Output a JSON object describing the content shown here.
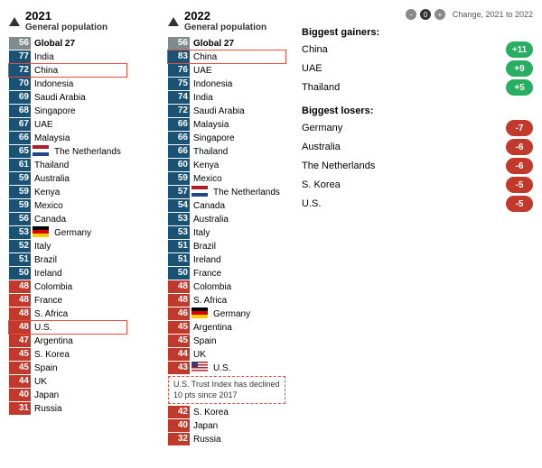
{
  "header2021": {
    "year": "2021",
    "sub": "General population"
  },
  "header2022": {
    "year": "2022",
    "sub": "General population"
  },
  "legend": {
    "change_label": "Change, 2021 to 2022",
    "biggest_gainers_title": "Biggest gainers:",
    "biggest_losers_title": "Biggest losers:",
    "gainers": [
      {
        "country": "China",
        "change": "+11"
      },
      {
        "country": "UAE",
        "change": "+9"
      },
      {
        "country": "Thailand",
        "change": "+5"
      }
    ],
    "losers": [
      {
        "country": "Germany",
        "change": "-7"
      },
      {
        "country": "Australia",
        "change": "-6"
      },
      {
        "country": "The Netherlands",
        "change": "-6"
      },
      {
        "country": "S. Korea",
        "change": "-5"
      },
      {
        "country": "U.S.",
        "change": "-5"
      }
    ]
  },
  "col2021": [
    {
      "score": "56",
      "name": "Global 27",
      "type": "global"
    },
    {
      "score": "77",
      "name": "India",
      "type": "blue"
    },
    {
      "score": "72",
      "name": "China",
      "type": "blue",
      "highlight": true
    },
    {
      "score": "70",
      "name": "Indonesia",
      "type": "blue"
    },
    {
      "score": "69",
      "name": "Saudi Arabia",
      "type": "blue"
    },
    {
      "score": "68",
      "name": "Singapore",
      "type": "blue"
    },
    {
      "score": "67",
      "name": "UAE",
      "type": "blue"
    },
    {
      "score": "66",
      "name": "Malaysia",
      "type": "blue"
    },
    {
      "score": "65",
      "name": "The Netherlands",
      "type": "blue",
      "flag": "nl"
    },
    {
      "score": "61",
      "name": "Thailand",
      "type": "blue"
    },
    {
      "score": "59",
      "name": "Australia",
      "type": "blue"
    },
    {
      "score": "59",
      "name": "Kenya",
      "type": "blue"
    },
    {
      "score": "59",
      "name": "Mexico",
      "type": "blue"
    },
    {
      "score": "56",
      "name": "Canada",
      "type": "blue"
    },
    {
      "score": "53",
      "name": "Germany",
      "type": "blue",
      "flag": "de"
    },
    {
      "score": "52",
      "name": "Italy",
      "type": "blue"
    },
    {
      "score": "51",
      "name": "Brazil",
      "type": "blue"
    },
    {
      "score": "50",
      "name": "Ireland",
      "type": "blue"
    },
    {
      "score": "48",
      "name": "Colombia",
      "type": "red"
    },
    {
      "score": "48",
      "name": "France",
      "type": "red"
    },
    {
      "score": "48",
      "name": "S. Africa",
      "type": "red"
    },
    {
      "score": "48",
      "name": "U.S.",
      "type": "red",
      "highlight": true
    },
    {
      "score": "47",
      "name": "Argentina",
      "type": "red"
    },
    {
      "score": "45",
      "name": "S. Korea",
      "type": "red"
    },
    {
      "score": "45",
      "name": "Spain",
      "type": "red"
    },
    {
      "score": "44",
      "name": "UK",
      "type": "red"
    },
    {
      "score": "40",
      "name": "Japan",
      "type": "red"
    },
    {
      "score": "31",
      "name": "Russia",
      "type": "red"
    }
  ],
  "col2022": [
    {
      "score": "56",
      "name": "Global 27",
      "type": "global"
    },
    {
      "score": "83",
      "name": "China",
      "type": "blue",
      "highlight": true
    },
    {
      "score": "76",
      "name": "UAE",
      "type": "blue"
    },
    {
      "score": "75",
      "name": "Indonesia",
      "type": "blue"
    },
    {
      "score": "74",
      "name": "India",
      "type": "blue"
    },
    {
      "score": "72",
      "name": "Saudi Arabia",
      "type": "blue"
    },
    {
      "score": "66",
      "name": "Malaysia",
      "type": "blue"
    },
    {
      "score": "66",
      "name": "Singapore",
      "type": "blue"
    },
    {
      "score": "66",
      "name": "Thailand",
      "type": "blue"
    },
    {
      "score": "60",
      "name": "Kenya",
      "type": "blue"
    },
    {
      "score": "59",
      "name": "Mexico",
      "type": "blue"
    },
    {
      "score": "57",
      "name": "The Netherlands",
      "type": "blue",
      "flag": "nl"
    },
    {
      "score": "54",
      "name": "Canada",
      "type": "blue"
    },
    {
      "score": "53",
      "name": "Australia",
      "type": "blue"
    },
    {
      "score": "53",
      "name": "Italy",
      "type": "blue"
    },
    {
      "score": "51",
      "name": "Brazil",
      "type": "blue"
    },
    {
      "score": "51",
      "name": "Ireland",
      "type": "blue"
    },
    {
      "score": "50",
      "name": "France",
      "type": "blue"
    },
    {
      "score": "48",
      "name": "Colombia",
      "type": "red"
    },
    {
      "score": "48",
      "name": "S. Africa",
      "type": "red"
    },
    {
      "score": "46",
      "name": "Germany",
      "type": "red",
      "flag": "de"
    },
    {
      "score": "45",
      "name": "Argentina",
      "type": "red"
    },
    {
      "score": "45",
      "name": "Spain",
      "type": "red"
    },
    {
      "score": "44",
      "name": "UK",
      "type": "red"
    },
    {
      "score": "43",
      "name": "U.S.",
      "type": "red",
      "highlight_dashed": true
    },
    {
      "score": "42",
      "name": "S. Korea",
      "type": "red"
    },
    {
      "score": "40",
      "name": "Japan",
      "type": "red"
    },
    {
      "score": "32",
      "name": "Russia",
      "type": "red"
    }
  ],
  "annotation": "U.S. Trust Index has declined 10 pts since 2017"
}
